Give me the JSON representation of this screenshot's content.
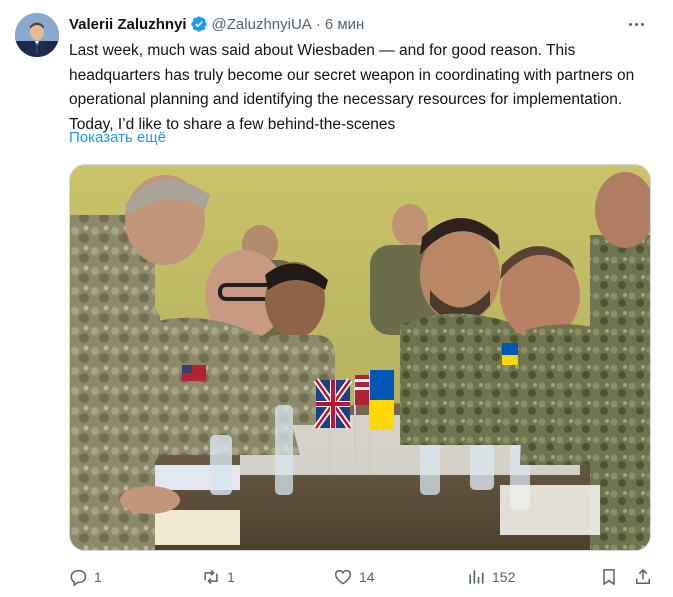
{
  "tweet": {
    "author_name": "Valerii Zaluzhnyi",
    "handle": "@ZaluzhnyiUA",
    "separator": "·",
    "time": "6 мин",
    "text": "Last week, much was said about Wiesbaden — and for good reason. This headquarters has truly become our secret weapon in coordinating with partners on operational planning and identifying the necessary resources for implementation. Today, I’d like to share a few behind-the-scenes",
    "show_more": "Показать ещё",
    "verified_icon": "verified-badge-icon",
    "media_description_icon": "photo-media"
  },
  "actions": {
    "replies": "1",
    "reposts": "1",
    "likes": "14",
    "views": "152"
  },
  "colors": {
    "link": "#1d9bf0",
    "secondary_text": "#536471",
    "verified": "#1d9bf0"
  }
}
